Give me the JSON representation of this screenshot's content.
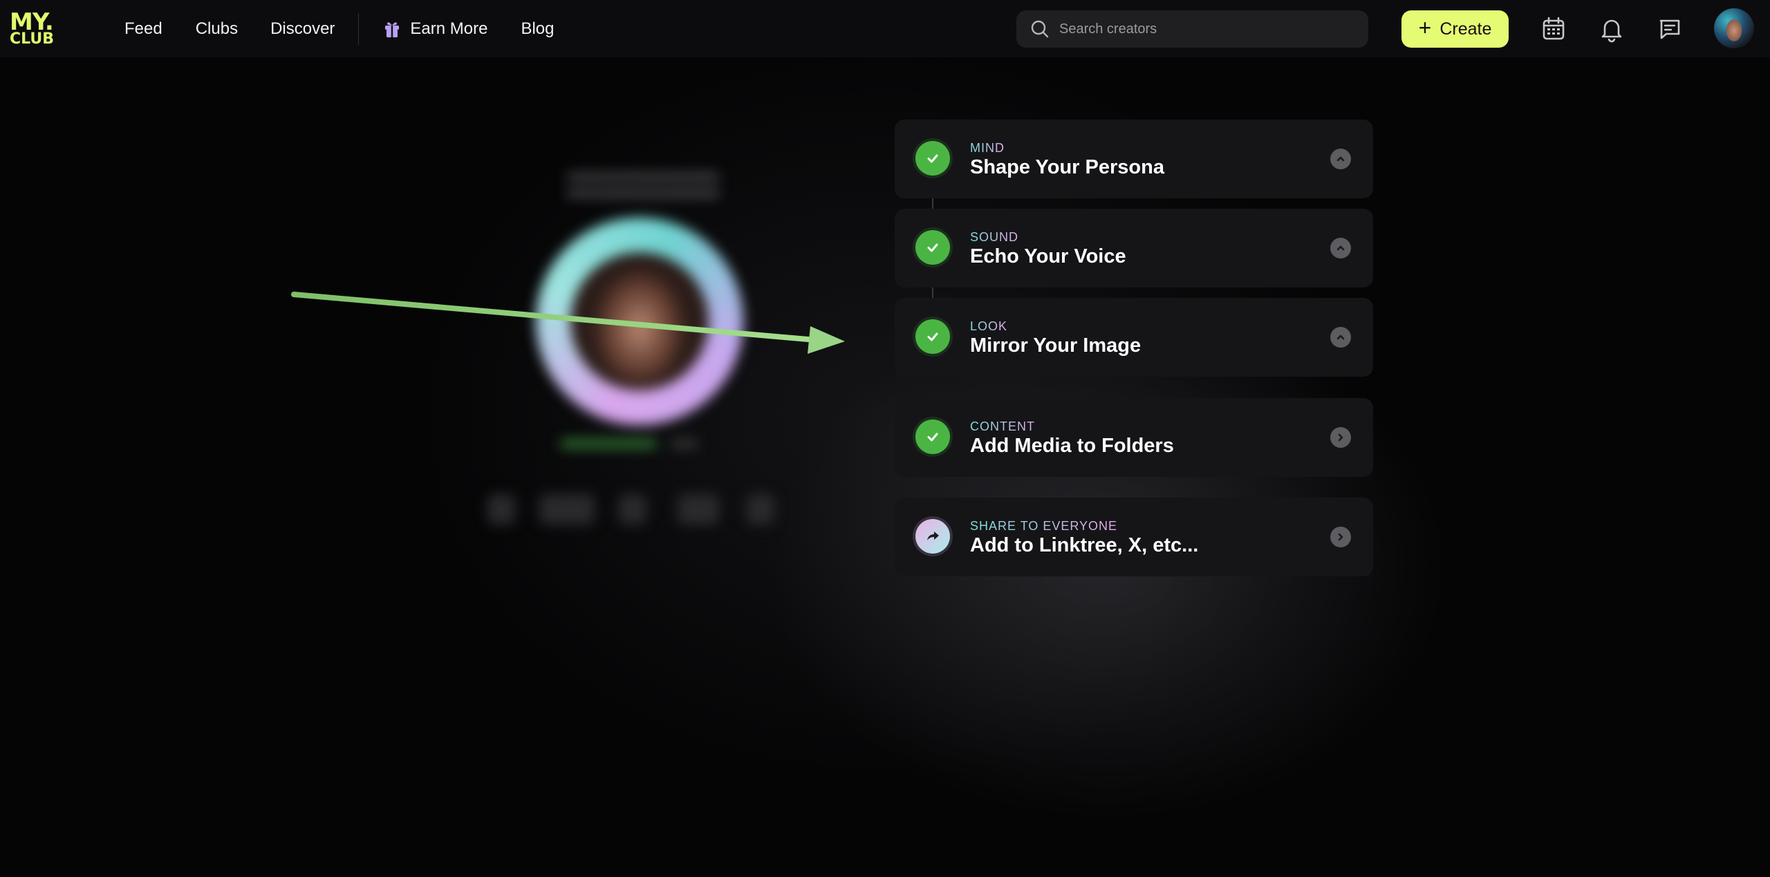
{
  "brand": {
    "logo_line1": "MY.",
    "logo_line2": "CLUB"
  },
  "nav": {
    "feed": "Feed",
    "clubs": "Clubs",
    "discover": "Discover",
    "earn_more": "Earn More",
    "blog": "Blog"
  },
  "search": {
    "placeholder": "Search creators"
  },
  "header": {
    "create_label": "Create"
  },
  "colors": {
    "accent": "#e6fb74",
    "check_green": "#4bb543",
    "arrow_green": "#8fcf7a",
    "gift_purple": "#b9a2f2"
  },
  "steps": [
    {
      "category": "MIND",
      "title": "Shape Your Persona",
      "status": "completed",
      "toggle_icon": "chevron-up-icon"
    },
    {
      "category": "SOUND",
      "title": "Echo Your Voice",
      "status": "completed",
      "toggle_icon": "chevron-up-icon"
    },
    {
      "category": "LOOK",
      "title": "Mirror Your Image",
      "status": "completed",
      "toggle_icon": "chevron-up-icon"
    },
    {
      "category": "CONTENT",
      "title": "Add Media to Folders",
      "status": "completed",
      "toggle_icon": "chevron-right-icon"
    },
    {
      "category": "SHARE TO EVERYONE",
      "title": "Add to Linktree, X, etc...",
      "status": "share",
      "toggle_icon": "chevron-right-icon"
    }
  ]
}
